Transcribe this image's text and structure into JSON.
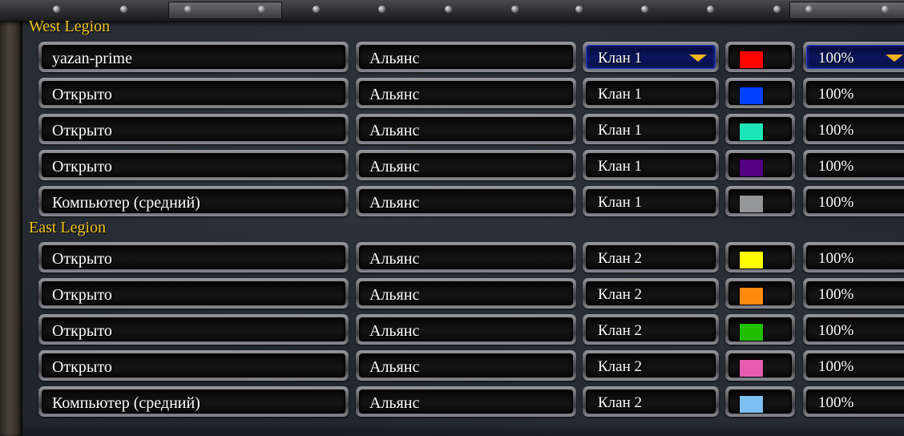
{
  "teams": [
    {
      "name": "West Legion",
      "slots": [
        {
          "player": "yazan-prime",
          "race": "Альянс",
          "team": "Клан 1",
          "color": "#ff0303",
          "handicap": "100%",
          "selected": true
        },
        {
          "player": "Открыто",
          "race": "Альянс",
          "team": "Клан 1",
          "color": "#0042ff",
          "handicap": "100%",
          "selected": false
        },
        {
          "player": "Открыто",
          "race": "Альянс",
          "team": "Клан 1",
          "color": "#1ce6b9",
          "handicap": "100%",
          "selected": false
        },
        {
          "player": "Открыто",
          "race": "Альянс",
          "team": "Клан 1",
          "color": "#540081",
          "handicap": "100%",
          "selected": false
        },
        {
          "player": "Компьютер (средний)",
          "race": "Альянс",
          "team": "Клан 1",
          "color": "#959697",
          "handicap": "100%",
          "selected": false
        }
      ]
    },
    {
      "name": "East Legion",
      "slots": [
        {
          "player": "Открыто",
          "race": "Альянс",
          "team": "Клан 2",
          "color": "#fffc01",
          "handicap": "100%",
          "selected": false
        },
        {
          "player": "Открыто",
          "race": "Альянс",
          "team": "Клан 2",
          "color": "#fe8a0e",
          "handicap": "100%",
          "selected": false
        },
        {
          "player": "Открыто",
          "race": "Альянс",
          "team": "Клан 2",
          "color": "#20c000",
          "handicap": "100%",
          "selected": false
        },
        {
          "player": "Открыто",
          "race": "Альянс",
          "team": "Клан 2",
          "color": "#e55bb0",
          "handicap": "100%",
          "selected": false
        },
        {
          "player": "Компьютер (средний)",
          "race": "Альянс",
          "team": "Клан 2",
          "color": "#7ebff1",
          "handicap": "100%",
          "selected": false
        }
      ]
    }
  ],
  "icons": {
    "dropdown": "chevron-down-icon"
  },
  "accent": "#f2c51a"
}
